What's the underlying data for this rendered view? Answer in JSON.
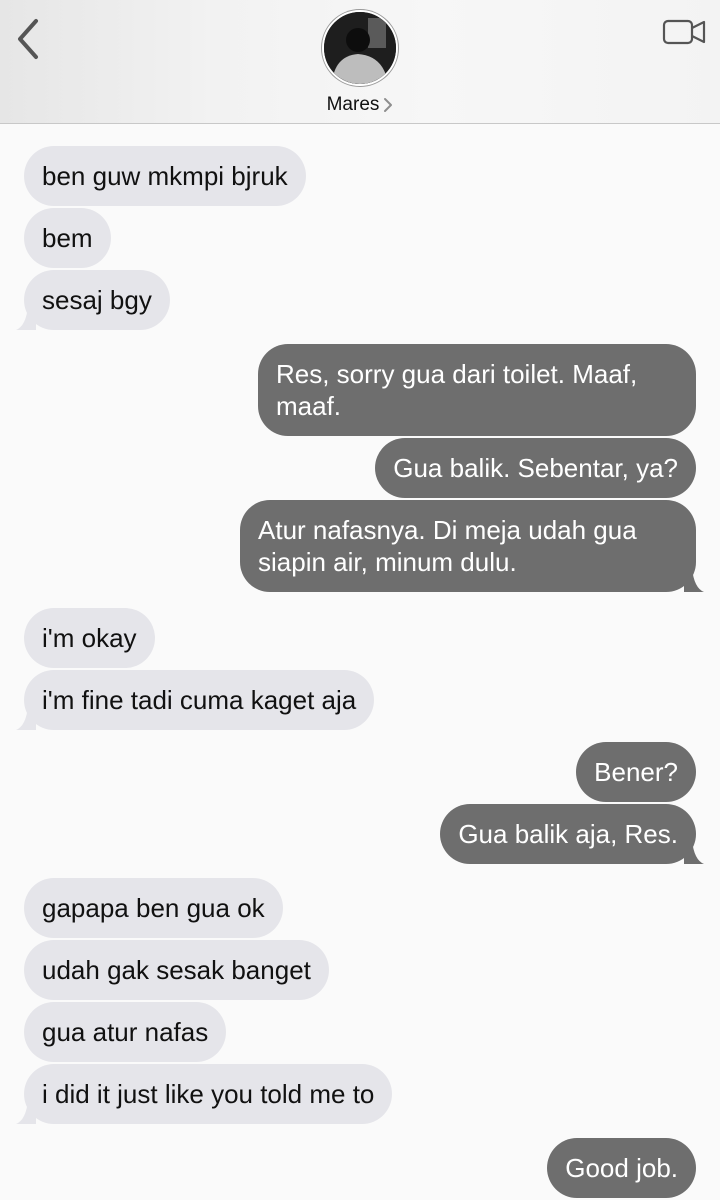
{
  "header": {
    "contact_name": "Mares"
  },
  "colors": {
    "incoming_bubble": "#e5e5ea",
    "outgoing_bubble": "#6e6e6e",
    "outgoing_text": "#ffffff"
  },
  "icons": {
    "back": "chevron-left-icon",
    "video": "video-camera-icon",
    "name_chevron": "chevron-right-icon"
  },
  "messages": [
    {
      "dir": "in",
      "text": "ben guw mkmpi bjruk"
    },
    {
      "dir": "in",
      "text": "bem"
    },
    {
      "dir": "in",
      "text": "sesaj bgy"
    },
    {
      "dir": "out",
      "text": "Res, sorry gua dari toilet. Maaf, maaf."
    },
    {
      "dir": "out",
      "text": "Gua balik. Sebentar, ya?"
    },
    {
      "dir": "out",
      "text": "Atur nafasnya. Di meja udah gua siapin air, minum dulu."
    },
    {
      "dir": "in",
      "text": "i'm okay"
    },
    {
      "dir": "in",
      "text": "i'm fine tadi cuma kaget aja"
    },
    {
      "dir": "out",
      "text": "Bener?"
    },
    {
      "dir": "out",
      "text": "Gua balik aja, Res."
    },
    {
      "dir": "in",
      "text": "gapapa ben gua ok"
    },
    {
      "dir": "in",
      "text": "udah gak sesak banget"
    },
    {
      "dir": "in",
      "text": "gua atur nafas"
    },
    {
      "dir": "in",
      "text": "i did it just like you told me to"
    },
    {
      "dir": "out",
      "text": "Good job."
    }
  ]
}
